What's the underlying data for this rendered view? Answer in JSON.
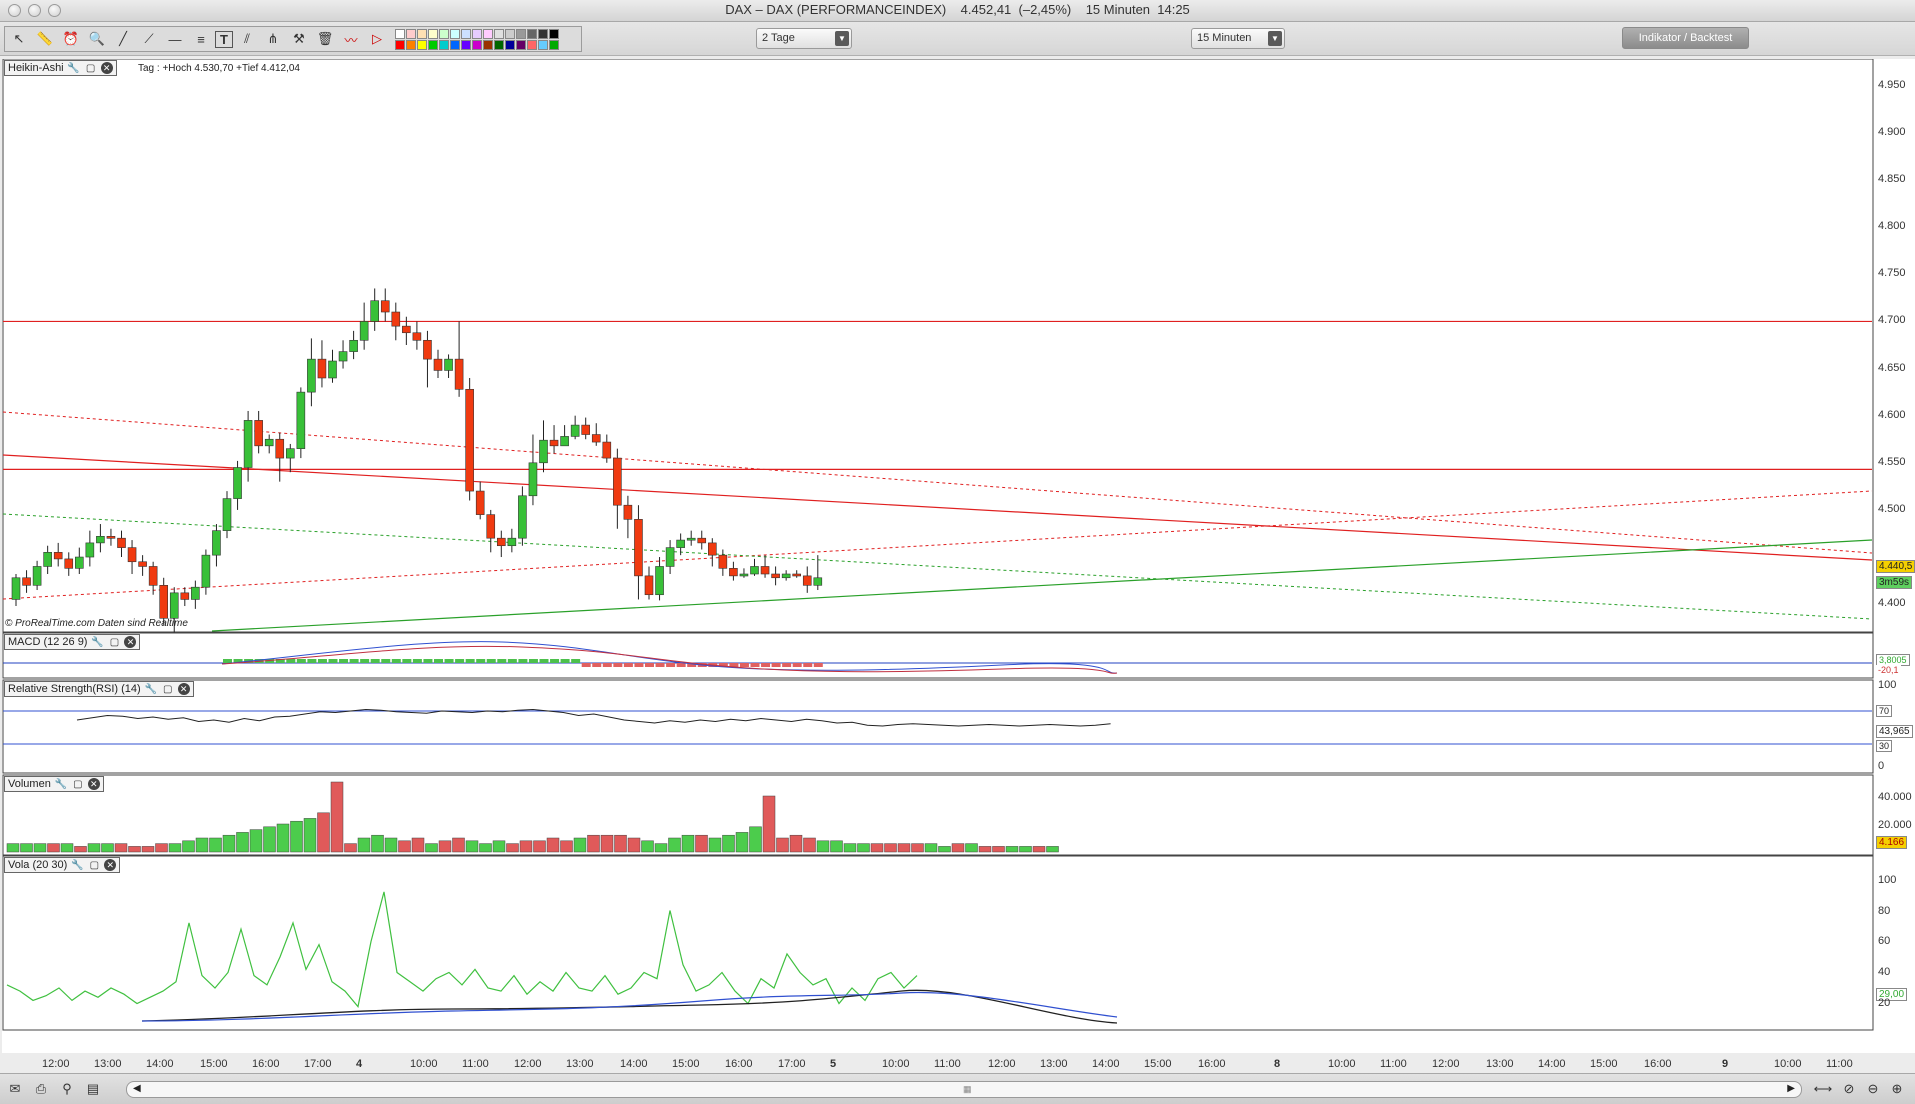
{
  "window": {
    "title": "DAX – DAX (PERFORMANCEINDEX)    4.452,41  (–2,45%)    15 Minuten  14:25"
  },
  "toolbar": {
    "period_select": "2 Tage",
    "interval_select": "15 Minuten",
    "indicator_button": "Indikator / Backtest",
    "tools": [
      "pointer-icon",
      "ruler-icon",
      "alarm-icon",
      "zoom-icon",
      "line-icon",
      "ray-icon",
      "hline-icon",
      "fib-icon",
      "text-icon",
      "channel-icon",
      "pitchfork-icon",
      "magnet-icon",
      "trash-icon",
      "trend-icon",
      "arrow-tool-icon"
    ],
    "palette": [
      "#ffffff",
      "#ffcccc",
      "#ffe0b3",
      "#ffffcc",
      "#ccffcc",
      "#ccffff",
      "#cce0ff",
      "#e6ccff",
      "#ffccff",
      "#e0e0e0",
      "#cccccc",
      "#999999",
      "#666666",
      "#333333",
      "#000000",
      "#ff0000",
      "#ff8000",
      "#ffff00",
      "#00cc00",
      "#00cccc",
      "#0066ff",
      "#6600ff",
      "#cc00cc",
      "#993300",
      "#006600",
      "#000099",
      "#660066",
      "#ff6666",
      "#66ccff",
      "#00aa00"
    ]
  },
  "main_panel": {
    "label": "Heikin-Ashi",
    "info": "Tag : +Hoch 4.530,70 +Tief 4.412,04",
    "credit": "© ProRealTime.com  Daten sind Realtime",
    "y_ticks": [
      "4.950",
      "4.900",
      "4.850",
      "4.800",
      "4.750",
      "4.700",
      "4.650",
      "4.600",
      "4.550",
      "4.500",
      "4.400"
    ],
    "price_tag": "4.440,5",
    "countdown_tag": "3m59s"
  },
  "macd_panel": {
    "label": "MACD (12 26 9)",
    "tag": "3,8005",
    "tag2": "-20,1"
  },
  "rsi_panel": {
    "label": "Relative Strength(RSI) (14)",
    "y_ticks": [
      "100",
      "0"
    ],
    "tags": [
      "70",
      "30"
    ],
    "value_tag": "43,965"
  },
  "volume_panel": {
    "label": "Volumen",
    "y_ticks": [
      "40.000",
      "20.000"
    ],
    "value_tag": "4.166"
  },
  "vola_panel": {
    "label": "Vola (20 30)",
    "y_ticks": [
      "100",
      "80",
      "60",
      "40",
      "20"
    ],
    "value_tag": "29,00"
  },
  "time_axis": [
    "12:00",
    "13:00",
    "14:00",
    "15:00",
    "16:00",
    "17:00",
    "4",
    "10:00",
    "11:00",
    "12:00",
    "13:00",
    "14:00",
    "15:00",
    "16:00",
    "17:00",
    "5",
    "10:00",
    "11:00",
    "12:00",
    "13:00",
    "14:00",
    "15:00",
    "16:00",
    "8",
    "10:00",
    "11:00",
    "12:00",
    "13:00",
    "14:00",
    "15:00",
    "16:00",
    "9",
    "10:00",
    "11:00"
  ],
  "chart_data": {
    "type": "candlestick",
    "title": "DAX – DAX (PERFORMANCEINDEX)",
    "timeframe": "15 Minuten",
    "candles": [
      [
        4405,
        4428,
        4398,
        4432
      ],
      [
        4428,
        4420,
        4412,
        4436
      ],
      [
        4420,
        4440,
        4415,
        4446
      ],
      [
        4440,
        4455,
        4432,
        4462
      ],
      [
        4455,
        4448,
        4440,
        4465
      ],
      [
        4448,
        4438,
        4430,
        4455
      ],
      [
        4438,
        4450,
        4432,
        4460
      ],
      [
        4450,
        4465,
        4440,
        4478
      ],
      [
        4465,
        4472,
        4455,
        4485
      ],
      [
        4472,
        4470,
        4462,
        4480
      ],
      [
        4470,
        4460,
        4450,
        4478
      ],
      [
        4460,
        4445,
        4432,
        4468
      ],
      [
        4445,
        4440,
        4430,
        4452
      ],
      [
        4440,
        4420,
        4410,
        4445
      ],
      [
        4420,
        4385,
        4378,
        4428
      ],
      [
        4385,
        4412,
        4370,
        4418
      ],
      [
        4412,
        4405,
        4398,
        4418
      ],
      [
        4405,
        4418,
        4395,
        4425
      ],
      [
        4418,
        4452,
        4410,
        4458
      ],
      [
        4452,
        4478,
        4440,
        4485
      ],
      [
        4478,
        4512,
        4470,
        4520
      ],
      [
        4512,
        4545,
        4500,
        4552
      ],
      [
        4545,
        4595,
        4530,
        4605
      ],
      [
        4595,
        4568,
        4560,
        4605
      ],
      [
        4568,
        4575,
        4560,
        4580
      ],
      [
        4575,
        4555,
        4530,
        4582
      ],
      [
        4555,
        4565,
        4540,
        4570
      ],
      [
        4565,
        4625,
        4555,
        4630
      ],
      [
        4625,
        4660,
        4610,
        4682
      ],
      [
        4660,
        4640,
        4630,
        4680
      ],
      [
        4640,
        4658,
        4635,
        4670
      ],
      [
        4658,
        4668,
        4650,
        4680
      ],
      [
        4668,
        4680,
        4660,
        4690
      ],
      [
        4680,
        4700,
        4670,
        4720
      ],
      [
        4700,
        4722,
        4690,
        4735
      ],
      [
        4722,
        4710,
        4700,
        4735
      ],
      [
        4710,
        4695,
        4680,
        4720
      ],
      [
        4695,
        4688,
        4675,
        4705
      ],
      [
        4688,
        4680,
        4670,
        4700
      ],
      [
        4680,
        4660,
        4630,
        4690
      ],
      [
        4660,
        4648,
        4640,
        4670
      ],
      [
        4648,
        4660,
        4640,
        4665
      ],
      [
        4660,
        4628,
        4620,
        4700
      ],
      [
        4628,
        4520,
        4510,
        4640
      ],
      [
        4520,
        4495,
        4490,
        4530
      ],
      [
        4495,
        4470,
        4455,
        4500
      ],
      [
        4470,
        4462,
        4450,
        4478
      ],
      [
        4462,
        4470,
        4455,
        4480
      ],
      [
        4470,
        4515,
        4462,
        4525
      ],
      [
        4515,
        4550,
        4505,
        4580
      ],
      [
        4550,
        4574,
        4540,
        4595
      ],
      [
        4574,
        4568,
        4560,
        4590
      ],
      [
        4568,
        4578,
        4570,
        4590
      ],
      [
        4578,
        4590,
        4575,
        4600
      ],
      [
        4590,
        4580,
        4575,
        4598
      ],
      [
        4580,
        4572,
        4568,
        4592
      ],
      [
        4572,
        4555,
        4550,
        4580
      ],
      [
        4555,
        4505,
        4480,
        4565
      ],
      [
        4505,
        4490,
        4470,
        4515
      ],
      [
        4490,
        4430,
        4405,
        4505
      ],
      [
        4430,
        4410,
        4405,
        4440
      ],
      [
        4410,
        4440,
        4404,
        4450
      ],
      [
        4440,
        4460,
        4432,
        4468
      ],
      [
        4460,
        4468,
        4452,
        4475
      ],
      [
        4468,
        4470,
        4462,
        4478
      ],
      [
        4470,
        4465,
        4458,
        4478
      ],
      [
        4465,
        4452,
        4440,
        4470
      ],
      [
        4452,
        4438,
        4430,
        4458
      ],
      [
        4438,
        4430,
        4425,
        4445
      ],
      [
        4430,
        4432,
        4428,
        4438
      ],
      [
        4432,
        4440,
        4430,
        4448
      ],
      [
        4440,
        4432,
        4428,
        4452
      ],
      [
        4432,
        4428,
        4420,
        4440
      ],
      [
        4428,
        4432,
        4425,
        4436
      ],
      [
        4432,
        4430,
        4428,
        4436
      ],
      [
        4430,
        4420,
        4412,
        4440
      ],
      [
        4420,
        4428,
        4415,
        4452
      ]
    ],
    "horizontal_lines": [
      4700,
      4543
    ],
    "ylim": [
      4380,
      4970
    ]
  }
}
